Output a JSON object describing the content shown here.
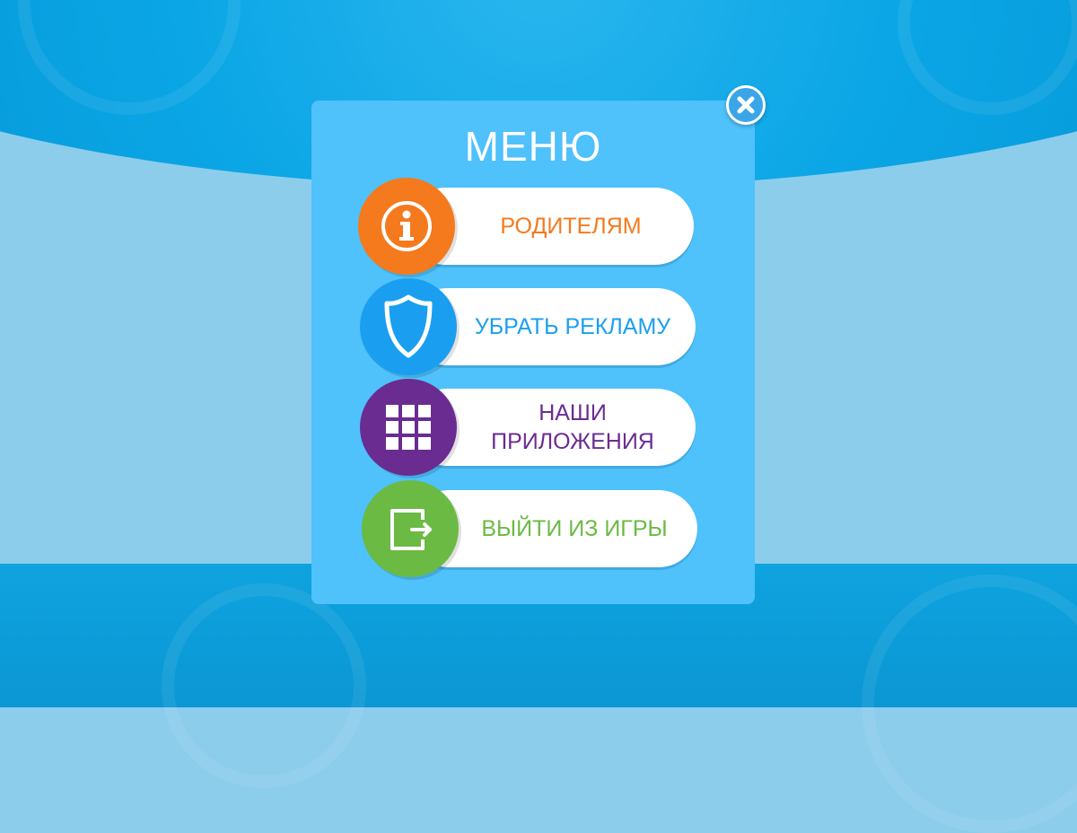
{
  "menu": {
    "title": "МЕНЮ",
    "items": [
      {
        "label": "РОДИТЕЛЯМ",
        "icon": "info-icon",
        "color": "#f47a1d"
      },
      {
        "label": "УБРАТЬ РЕКЛАМУ",
        "icon": "shield-icon",
        "color": "#1a9ff0"
      },
      {
        "label_line1": "НАШИ",
        "label_line2": "ПРИЛОЖЕНИЯ",
        "icon": "grid-icon",
        "color": "#6a2c91"
      },
      {
        "label": "ВЫЙТИ ИЗ ИГРЫ",
        "icon": "exit-icon",
        "color": "#6bba44"
      }
    ]
  },
  "colors": {
    "panel": "#4fc1fb",
    "background": "#8ccdec",
    "title": "#ffffff"
  },
  "close_icon": "close-icon"
}
